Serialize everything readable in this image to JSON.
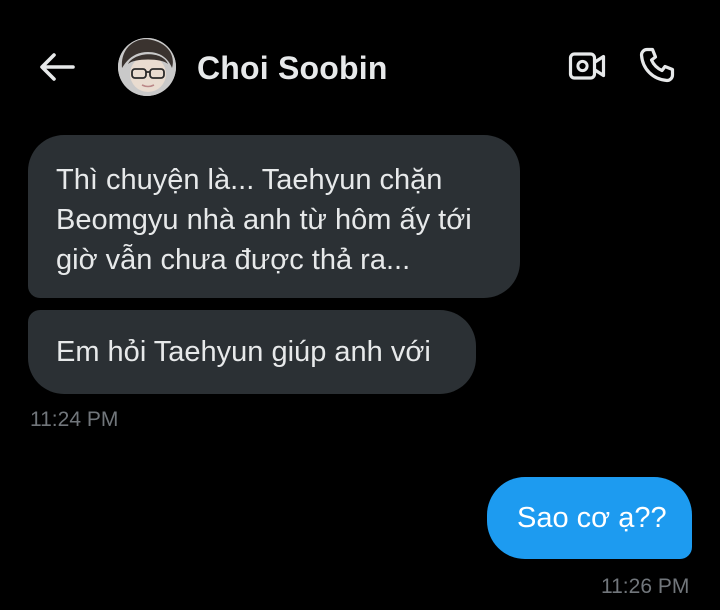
{
  "header": {
    "back_icon": "arrow-left-icon",
    "contact_name": "Choi Soobin",
    "video_icon": "video-camera-icon",
    "call_icon": "phone-icon"
  },
  "messages": [
    {
      "direction": "incoming",
      "text": "Thì chuyện là... Taehyun chặn Beomgyu nhà anh từ hôm ấy tới giờ vẫn chưa được thả ra..."
    },
    {
      "direction": "incoming",
      "text": "Em hỏi Taehyun giúp anh với",
      "timestamp": "11:24 PM"
    },
    {
      "direction": "outgoing",
      "text": "Sao cơ ạ??",
      "timestamp": "11:26 PM"
    }
  ],
  "colors": {
    "background": "#000000",
    "incoming_bubble": "#2b3034",
    "outgoing_bubble": "#1d9bf0",
    "primary_text": "#e7e9ea",
    "timestamp_text": "#71767b"
  }
}
